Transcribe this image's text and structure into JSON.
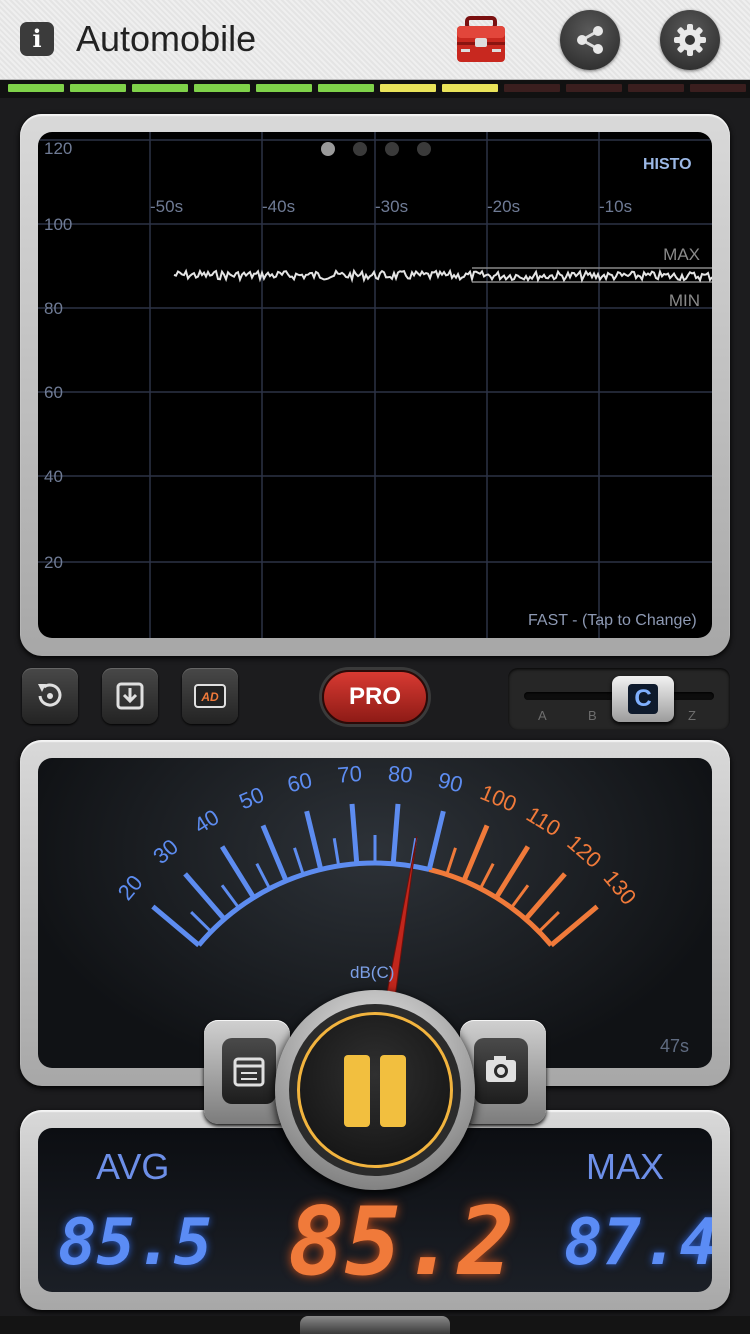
{
  "header": {
    "info_icon": "i",
    "title": "Automobile",
    "toolbox_icon": "toolbox-icon",
    "share_icon": "share-icon",
    "settings_icon": "gear-icon"
  },
  "level_bar": {
    "segments": [
      "green",
      "green",
      "green",
      "green",
      "green",
      "green",
      "yellow",
      "yellow",
      "off",
      "off",
      "off",
      "off"
    ],
    "colors": {
      "green": "#7fd24a",
      "yellow": "#e9e35a",
      "off": "#3a1e1e"
    }
  },
  "histogram": {
    "mode_label": "HISTO",
    "page_dots": 4,
    "active_page": 0,
    "y_ticks": [
      "120",
      "100",
      "80",
      "60",
      "40",
      "20"
    ],
    "x_ticks": [
      "-50s",
      "-40s",
      "-30s",
      "-20s",
      "-10s"
    ],
    "max_label": "MAX",
    "min_label": "MIN",
    "response_label": "FAST - (Tap to Change)"
  },
  "controls": {
    "reset_icon": "reset-icon",
    "save_icon": "download-icon",
    "ad_label": "AD",
    "pro_label": "PRO",
    "weighting_options": [
      "A",
      "B",
      "C",
      "Z"
    ],
    "weighting_selected": "C"
  },
  "meter": {
    "blue_ticks": [
      "20",
      "30",
      "40",
      "50",
      "60",
      "70",
      "80",
      "90"
    ],
    "orange_ticks": [
      "100",
      "110",
      "120",
      "130"
    ],
    "unit": "dB(C)",
    "elapsed": "47s",
    "needle_value": 85.2
  },
  "readout": {
    "avg_label": "AVG",
    "avg_value": "85.5",
    "current_value": "85.2",
    "max_label": "MAX",
    "max_value": "87.4"
  },
  "colors": {
    "blue": "#5d8cf0",
    "orange": "#f07a3a",
    "accent_yellow": "#f2bf3f"
  }
}
